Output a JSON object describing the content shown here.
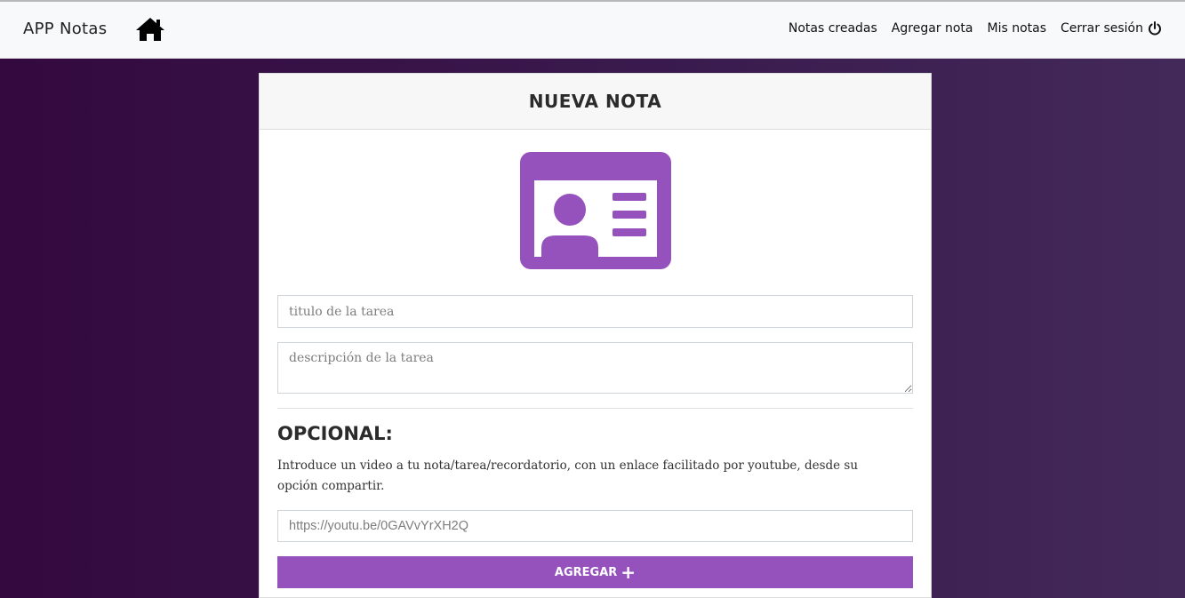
{
  "navbar": {
    "brand": "APP Notas",
    "links": [
      {
        "label": "Notas creadas"
      },
      {
        "label": "Agregar nota"
      },
      {
        "label": "Mis notas"
      },
      {
        "label": "Cerrar sesión"
      }
    ]
  },
  "card": {
    "title": "NUEVA NOTA",
    "title_placeholder": "titulo de la tarea",
    "description_placeholder": "descripción de la tarea",
    "optional_heading": "OPCIONAL:",
    "optional_text": "Introduce un video a tu nota/tarea/recordatorio, con un enlace facilitado por youtube, desde su opción compartir.",
    "url_placeholder": "https://youtu.be/0GAVvYrXH2Q",
    "submit_label": "AGREGAR",
    "submit_icon": "+"
  },
  "colors": {
    "accent": "#9552bd",
    "background_dark": "#33093f"
  },
  "icons": [
    "home-icon",
    "power-icon",
    "id-card-icon",
    "plus-icon"
  ]
}
